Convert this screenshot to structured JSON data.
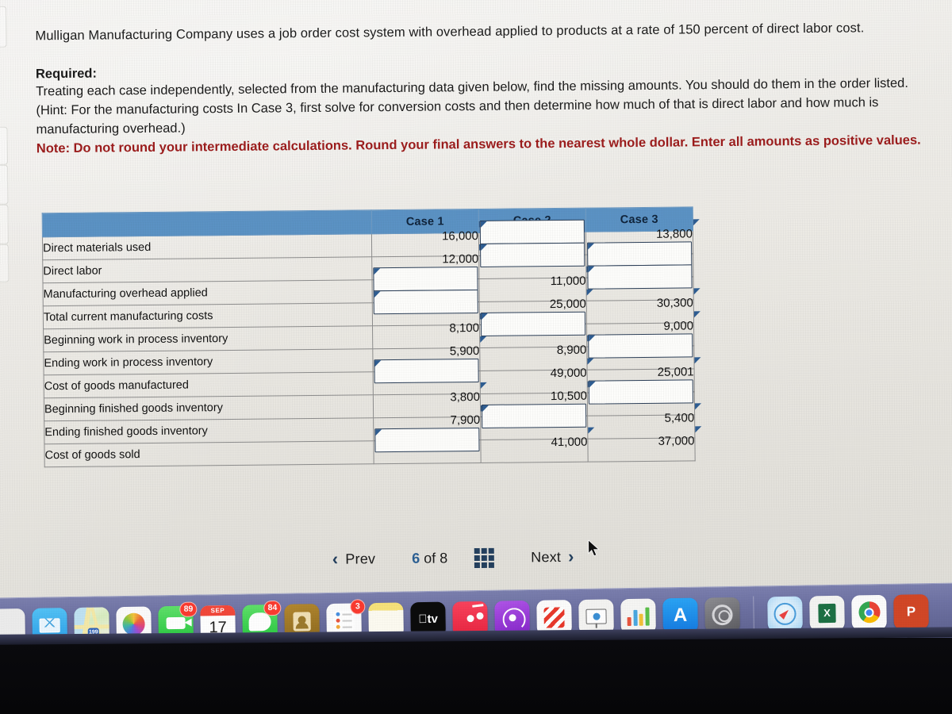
{
  "problem": {
    "intro": "Mulligan Manufacturing Company uses a job order cost system with overhead applied to products at a rate of 150 percent of direct labor cost.",
    "required_label": "Required:",
    "required_body": "Treating each case independently, selected from the manufacturing data given below, find the missing amounts. You should do them in the order listed. (Hint: For the manufacturing costs In Case 3, first solve for conversion costs and then determine how much of that is direct labor and how much is manufacturing overhead.)",
    "note": "Note: Do not round your intermediate calculations. Round your final answers to the nearest whole dollar. Enter all amounts as positive values."
  },
  "table": {
    "corner_header": "",
    "columns": [
      "Case 1",
      "Case 2",
      "Case 3"
    ],
    "rows": [
      {
        "label": "Direct materials used",
        "case1": "16,000",
        "case2": "",
        "case3": "13,800"
      },
      {
        "label": "Direct labor",
        "case1": "12,000",
        "case2": "",
        "case3": ""
      },
      {
        "label": "Manufacturing overhead applied",
        "case1": "",
        "case2": "11,000",
        "case3": ""
      },
      {
        "label": "Total current manufacturing costs",
        "case1": "",
        "case2": "25,000",
        "case3": "30,300"
      },
      {
        "label": "Beginning work in process inventory",
        "case1": "8,100",
        "case2": "",
        "case3": "9,000"
      },
      {
        "label": "Ending work in process inventory",
        "case1": "5,900",
        "case2": "8,900",
        "case3": ""
      },
      {
        "label": "Cost of goods manufactured",
        "case1": "",
        "case2": "49,000",
        "case3": "25,001"
      },
      {
        "label": "Beginning finished goods inventory",
        "case1": "3,800",
        "case2": "10,500",
        "case3": ""
      },
      {
        "label": "Ending finished goods inventory",
        "case1": "7,900",
        "case2": "",
        "case3": "5,400"
      },
      {
        "label": "Cost of goods sold",
        "case1": "",
        "case2": "41,000",
        "case3": "37,000"
      }
    ]
  },
  "pager": {
    "prev_label": "Prev",
    "prev_icon": "chevron-left-icon",
    "next_label": "Next",
    "next_icon": "chevron-right-icon",
    "current_page": "6",
    "of_word": "of",
    "total_pages": "8",
    "grid_icon": "grid-3x3-icon"
  },
  "colors": {
    "header_blue": "#5b92c4",
    "note_red": "#9c1c1c",
    "accent_blue": "#2b5f93",
    "input_border": "#2c3f58",
    "flag_blue": "#2e5d92",
    "dock_bg": "#6e72a3"
  },
  "dock": {
    "items": [
      {
        "name": "launchpad",
        "label": "",
        "badge": "",
        "running": false
      },
      {
        "name": "mail",
        "label": "",
        "badge": "",
        "running": false
      },
      {
        "name": "maps",
        "label": "199",
        "badge": "",
        "running": false
      },
      {
        "name": "photos",
        "label": "",
        "badge": "",
        "running": false
      },
      {
        "name": "facetime",
        "label": "",
        "badge": "89",
        "running": false
      },
      {
        "name": "calendar",
        "label": "17",
        "month": "SEP",
        "badge": "",
        "running": true
      },
      {
        "name": "messages",
        "label": "",
        "badge": "84",
        "running": true
      },
      {
        "name": "contacts",
        "label": "",
        "badge": "",
        "running": false
      },
      {
        "name": "reminders",
        "label": "",
        "badge": "3",
        "running": false
      },
      {
        "name": "notes",
        "label": "",
        "badge": "",
        "running": false
      },
      {
        "name": "tv",
        "label": "tv",
        "badge": "",
        "running": false
      },
      {
        "name": "music",
        "label": "",
        "badge": "",
        "running": false
      },
      {
        "name": "podcasts",
        "label": "",
        "badge": "",
        "running": false
      },
      {
        "name": "news",
        "label": "",
        "badge": "",
        "running": false
      },
      {
        "name": "keynote",
        "label": "",
        "badge": "",
        "running": false
      },
      {
        "name": "numbers",
        "label": "",
        "badge": "",
        "running": false
      },
      {
        "name": "app-store",
        "label": "A",
        "badge": "",
        "running": false
      },
      {
        "name": "system-settings",
        "label": "",
        "badge": "",
        "running": false
      },
      {
        "name": "safari",
        "label": "",
        "badge": "",
        "running": true
      },
      {
        "name": "excel",
        "label": "X",
        "badge": "",
        "running": true
      },
      {
        "name": "chrome",
        "label": "",
        "badge": "",
        "running": true
      },
      {
        "name": "powerpoint",
        "label": "P",
        "badge": "",
        "running": false
      }
    ]
  },
  "edge": {
    "fragment_text": "s"
  }
}
